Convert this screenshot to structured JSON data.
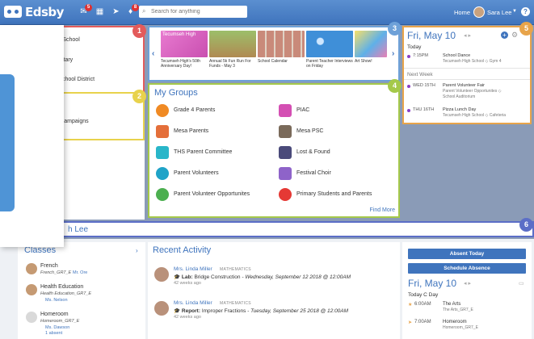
{
  "header": {
    "logo_text": "Edsby",
    "messages_badge": "5",
    "notifications_badge": "8",
    "search_placeholder": "Search for anything",
    "home_label": "Home",
    "user_name": "Sara Lee",
    "help_label": "?"
  },
  "popup": {
    "items": [
      "High School",
      "ementary",
      "irie School District"
    ],
    "section_title": "ons",
    "section_item": "tion Campaigns"
  },
  "markers": [
    "1",
    "2",
    "3",
    "4",
    "5",
    "6"
  ],
  "announcements": {
    "items": [
      {
        "caption": "Tecumseh High's 50th Anniversary Day!",
        "thumb_text": "Tecumseh High"
      },
      {
        "caption": "Annual 5k Fun Run For Funds - May 3"
      },
      {
        "caption": "School Calendar"
      },
      {
        "caption": "Parent Teacher Interviews on Friday"
      },
      {
        "caption": "Art Show!"
      }
    ],
    "prev_arrow": "‹",
    "next_arrow": "›"
  },
  "groups": {
    "title": "My Groups",
    "items": [
      {
        "label": "Grade 4 Parents",
        "color": "#f08a24"
      },
      {
        "label": "PIAC",
        "color": "#d44fb3"
      },
      {
        "label": "Mesa Parents",
        "color": "#e46f3a"
      },
      {
        "label": "Mesa PSC",
        "color": "#7a6a5a"
      },
      {
        "label": "THS Parent Committee",
        "color": "#29b6c9"
      },
      {
        "label": "Lost & Found",
        "color": "#4a4a7a"
      },
      {
        "label": "Parent Volunteers",
        "color": "#1fa3c8"
      },
      {
        "label": "Festival Choir",
        "color": "#8e63c9"
      },
      {
        "label": "Parent Volunteer Opportunites",
        "color": "#4caf50"
      },
      {
        "label": "Primary Students and Parents",
        "color": "#e53935"
      }
    ],
    "find_more": "Find More"
  },
  "calendar": {
    "title": "Fri, May 10",
    "today_label": "Today",
    "events_today": [
      {
        "time": "7:15PM",
        "name": "School Dance",
        "location": "Tecumseh High School ◇ Gym 4"
      }
    ],
    "next_week_label": "Next Week",
    "events_next": [
      {
        "time": "WED 15TH",
        "name": "Parent Volunteer Fair",
        "location": "Parent Volunteer Opportunites ◇",
        "location2": "School Auditorium"
      },
      {
        "time": "THU 16TH",
        "name": "Pizza Lunch Day",
        "location": "Tecumseh High School ◇ Cafeteria"
      }
    ]
  },
  "profile": {
    "name_fragment": "h Lee"
  },
  "classes": {
    "title": "Classes",
    "items": [
      {
        "name": "French",
        "section": "French_GR7_E",
        "teacher": "Mr. Ore"
      },
      {
        "name": "Health Education",
        "section": "Health Education_GR7_E",
        "teacher": "Ms. Nelson"
      },
      {
        "name": "Homeroom",
        "section": "Homeroom_GR7_E",
        "teacher": "Ms. Dawson",
        "absent": "1 absent"
      }
    ]
  },
  "activity": {
    "title": "Recent Activity",
    "items": [
      {
        "who": "Mrs. Linda Miller",
        "subject": "MATHEMATICS",
        "kind": "Lab:",
        "what": "Bridge Construction",
        "when": " - Wednesday, September 12 2018 @ 12:00AM",
        "ago": "42 weeks ago"
      },
      {
        "who": "Mrs. Linda Miller",
        "subject": "MATHEMATICS",
        "kind": "Report:",
        "what": "Improper Fractions",
        "when": " - Tuesday, September 25 2018 @ 12:00AM",
        "ago": "42 weeks ago"
      }
    ]
  },
  "right": {
    "absent_btn": "Absent Today",
    "schedule_btn": "Schedule Absence",
    "title": "Fri, May 10",
    "day_label": "Today   C Day",
    "events": [
      {
        "time": "6:00AM",
        "name": "The Arts",
        "sub": "The Arts_GR7_E"
      },
      {
        "time": "7:00AM",
        "name": "Homeroom",
        "sub": "Homeroom_GR7_E"
      }
    ]
  }
}
